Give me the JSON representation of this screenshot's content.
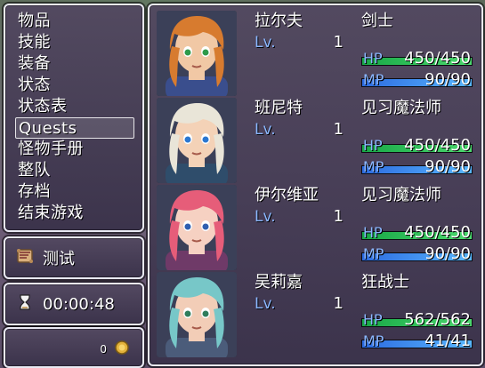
{
  "menu": {
    "items": [
      {
        "label": "物品"
      },
      {
        "label": "技能"
      },
      {
        "label": "装备"
      },
      {
        "label": "状态"
      },
      {
        "label": "状态表"
      },
      {
        "label": "Quests"
      },
      {
        "label": "怪物手册"
      },
      {
        "label": "整队"
      },
      {
        "label": "存档"
      },
      {
        "label": "结束游戏"
      }
    ],
    "selected_index": 5
  },
  "test_window": {
    "label": "测试",
    "icon": "scroll-icon"
  },
  "playtime_window": {
    "time": "00:00:48",
    "icon": "hourglass-icon"
  },
  "gold_window": {
    "value": "0",
    "icon": "gold-coin-icon"
  },
  "party": [
    {
      "name": "拉尔夫",
      "level_label": "Lv.",
      "level": "1",
      "class": "剑士",
      "hp": {
        "label": "HP",
        "text": "450/450",
        "ratio": 1
      },
      "mp": {
        "label": "MP",
        "text": "90/90",
        "ratio": 1
      },
      "face": {
        "hair": "#d77b2f",
        "skin": "#f1c8a5",
        "eye": "#2f9a4a",
        "outfit": "#3a4e8d"
      }
    },
    {
      "name": "班尼特",
      "level_label": "Lv.",
      "level": "1",
      "class": "见习魔法师",
      "hp": {
        "label": "HP",
        "text": "450/450",
        "ratio": 1
      },
      "mp": {
        "label": "MP",
        "text": "90/90",
        "ratio": 1
      },
      "face": {
        "hair": "#e9e5d8",
        "skin": "#f4d2b7",
        "eye": "#2b77d1",
        "outfit": "#2f4d6b"
      }
    },
    {
      "name": "伊尔维亚",
      "level_label": "Lv.",
      "level": "1",
      "class": "见习魔法师",
      "hp": {
        "label": "HP",
        "text": "450/450",
        "ratio": 1
      },
      "mp": {
        "label": "MP",
        "text": "90/90",
        "ratio": 1
      },
      "face": {
        "hair": "#e65d79",
        "skin": "#f6d1c2",
        "eye": "#2f5fb0",
        "outfit": "#6f3a68"
      }
    },
    {
      "name": "吴莉嘉",
      "level_label": "Lv.",
      "level": "1",
      "class": "狂战士",
      "hp": {
        "label": "HP",
        "text": "562/562",
        "ratio": 1
      },
      "mp": {
        "label": "MP",
        "text": "41/41",
        "ratio": 1
      },
      "face": {
        "hair": "#77c7c8",
        "skin": "#f2cdb7",
        "eye": "#2f7d5c",
        "outfit": "#4b5c7a"
      }
    }
  ]
}
